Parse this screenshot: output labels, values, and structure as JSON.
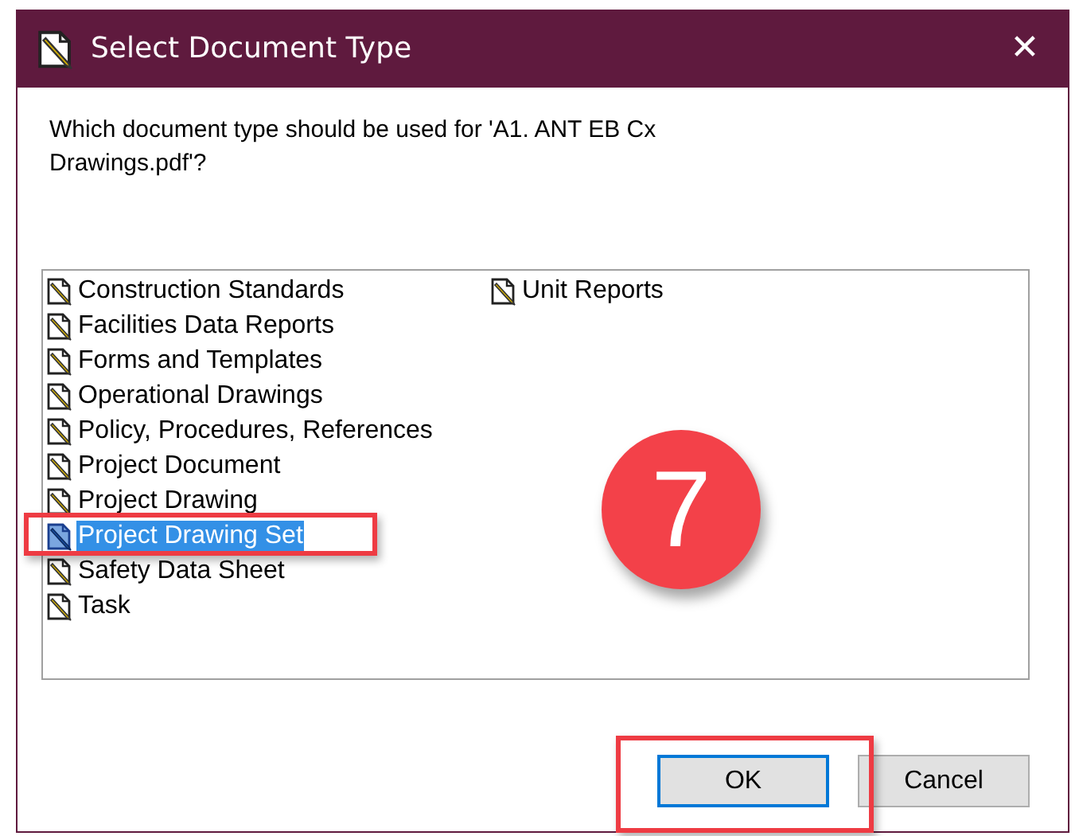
{
  "window": {
    "title": "Select Document Type",
    "close": "✕"
  },
  "prompt": "Which document type should be used for 'A1. ANT EB Cx Drawings.pdf'?",
  "document_types": [
    {
      "label": "Construction Standards",
      "selected": false
    },
    {
      "label": "Facilities Data Reports",
      "selected": false
    },
    {
      "label": "Forms and Templates",
      "selected": false
    },
    {
      "label": "Operational Drawings",
      "selected": false
    },
    {
      "label": "Policy, Procedures, References",
      "selected": false
    },
    {
      "label": "Project Document",
      "selected": false
    },
    {
      "label": "Project Drawing",
      "selected": false
    },
    {
      "label": "Project Drawing Set",
      "selected": true
    },
    {
      "label": "Safety Data Sheet",
      "selected": false
    },
    {
      "label": "Task",
      "selected": false
    },
    {
      "label": "Unit Reports",
      "selected": false
    }
  ],
  "step_badge": "7",
  "buttons": [
    {
      "label": "OK",
      "default": true
    },
    {
      "label": "Cancel",
      "default": false
    }
  ]
}
